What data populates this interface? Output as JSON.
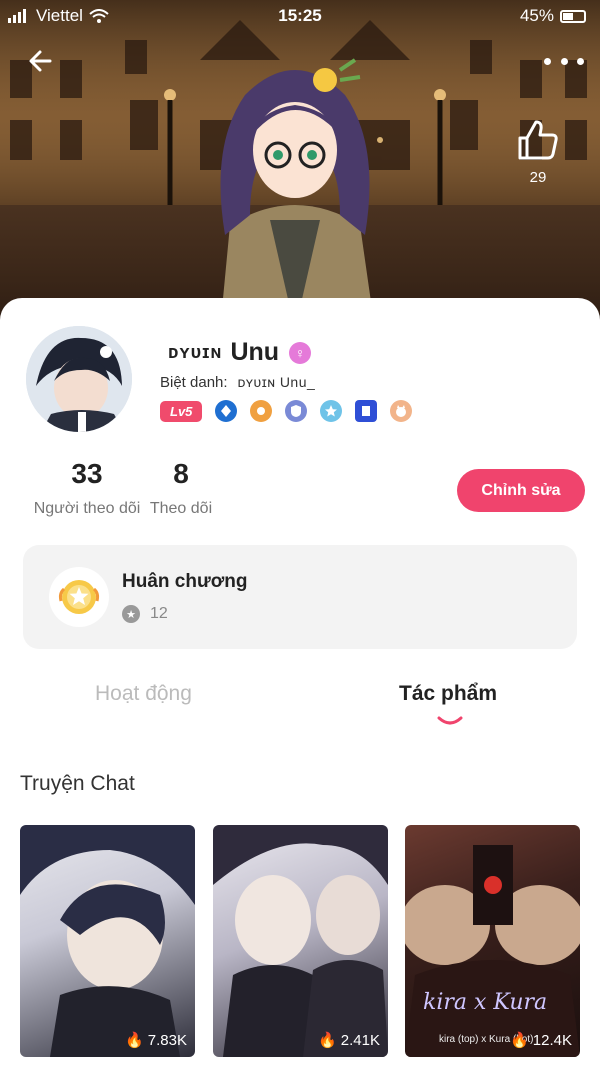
{
  "status_bar": {
    "carrier": "Viettel",
    "time": "15:25",
    "battery": "45%"
  },
  "cover": {
    "like_count": "29"
  },
  "profile": {
    "username_prefix": "ᴅʏᴜɪɴ",
    "username": "Unu",
    "gender_symbol": "♀",
    "nickname_label": "Biệt danh:",
    "nickname_value": "ᴅʏᴜɪɴ Unu_",
    "level_badge": "Lv5",
    "followers_count": "33",
    "followers_label": "Người theo dõi",
    "following_count": "8",
    "following_label": "Theo dõi",
    "edit_button": "Chỉnh sửa"
  },
  "medals": {
    "title": "Huân chương",
    "count": "12"
  },
  "tabs": [
    {
      "label": "Hoạt động",
      "active": false
    },
    {
      "label": "Tác phẩm",
      "active": true
    }
  ],
  "section": {
    "title": "Truyện Chat"
  },
  "stories": [
    {
      "views": "7.83K"
    },
    {
      "views": "2.41K"
    },
    {
      "views": "12.4K",
      "overlay_title": "kira x Kura",
      "overlay_sub": "kira (top) x Kura (bot)"
    }
  ],
  "colors": {
    "accent": "#f0446d",
    "level_badge": "#f04b6c",
    "gender_badge": "#e57ad9"
  }
}
